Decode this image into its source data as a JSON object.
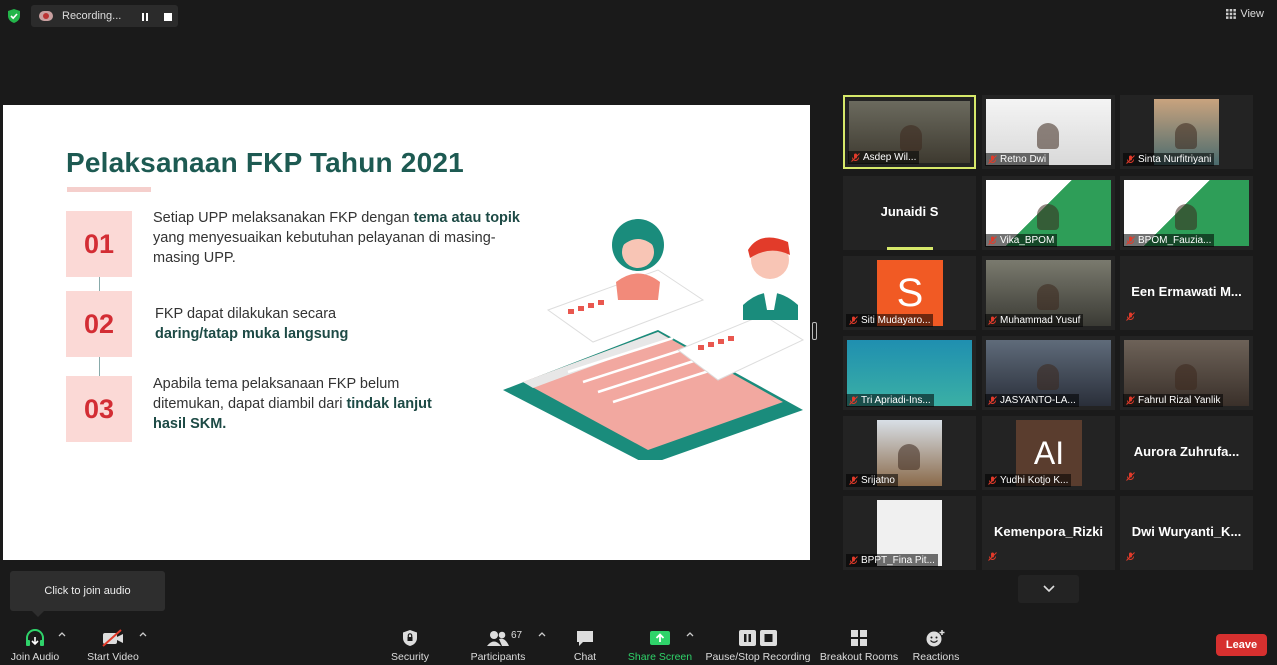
{
  "top": {
    "recording_label": "Recording...",
    "view_label": "View"
  },
  "slide": {
    "title": "Pelaksanaan FKP Tahun 2021",
    "items": [
      {
        "num": "01",
        "pre": "Setiap UPP melaksanakan FKP dengan ",
        "bold": "tema atau topik",
        "post": " yang menyesuaikan kebutuhan pelayanan di masing-masing UPP."
      },
      {
        "num": "02",
        "pre": "FKP dapat dilakukan secara ",
        "bold": "daring/tatap muka langsung",
        "post": ""
      },
      {
        "num": "03",
        "pre": "Apabila tema pelaksanaan FKP belum ditemukan, dapat diambil dari ",
        "bold": "tindak lanjut hasil SKM.",
        "post": ""
      }
    ]
  },
  "participants": [
    {
      "name": "Asdep Wil...",
      "type": "video"
    },
    {
      "name": "Retno Dwi",
      "type": "video"
    },
    {
      "name": "Sinta Nurfitriyani",
      "type": "video"
    },
    {
      "name": "Junaidi S",
      "type": "name"
    },
    {
      "name": "Vika_BPOM",
      "type": "video"
    },
    {
      "name": "BPOM_Fauzia...",
      "type": "video"
    },
    {
      "name": "Siti Mudayaro...",
      "type": "avatar",
      "avatar": "S"
    },
    {
      "name": "Muhammad Yusuf",
      "type": "video"
    },
    {
      "name": "Een  Ermawati  M...",
      "type": "name"
    },
    {
      "name": "Tri Apriadi-Ins...",
      "type": "video"
    },
    {
      "name": "JASYANTO-LA...",
      "type": "video"
    },
    {
      "name": "Fahrul Rizal Yanlik",
      "type": "video"
    },
    {
      "name": "Srijatno",
      "type": "video"
    },
    {
      "name": "Yudhi Kotjo K...",
      "type": "avatar",
      "avatar": "AI"
    },
    {
      "name": "Aurora  Zuhrufa...",
      "type": "name"
    },
    {
      "name": "BPPT_Fina Pit...",
      "type": "video"
    },
    {
      "name": "Kemenpora_Rizki",
      "type": "name"
    },
    {
      "name": "Dwi  Wuryanti_K...",
      "type": "name"
    }
  ],
  "tooltip": "Click to join audio",
  "toolbar": {
    "join_audio": "Join Audio",
    "start_video": "Start Video",
    "security": "Security",
    "participants": "Participants",
    "participants_count": "67",
    "chat": "Chat",
    "share_screen": "Share Screen",
    "pause_stop_recording": "Pause/Stop Recording",
    "breakout_rooms": "Breakout Rooms",
    "reactions": "Reactions",
    "leave": "Leave"
  },
  "colors": {
    "slide_accent": "#1d5a52",
    "number_red": "#d32d34",
    "number_bg": "#fbd9d6",
    "active_speaker": "#d6e86a",
    "share_green": "#2fd36a",
    "leave_red": "#d6302f"
  }
}
